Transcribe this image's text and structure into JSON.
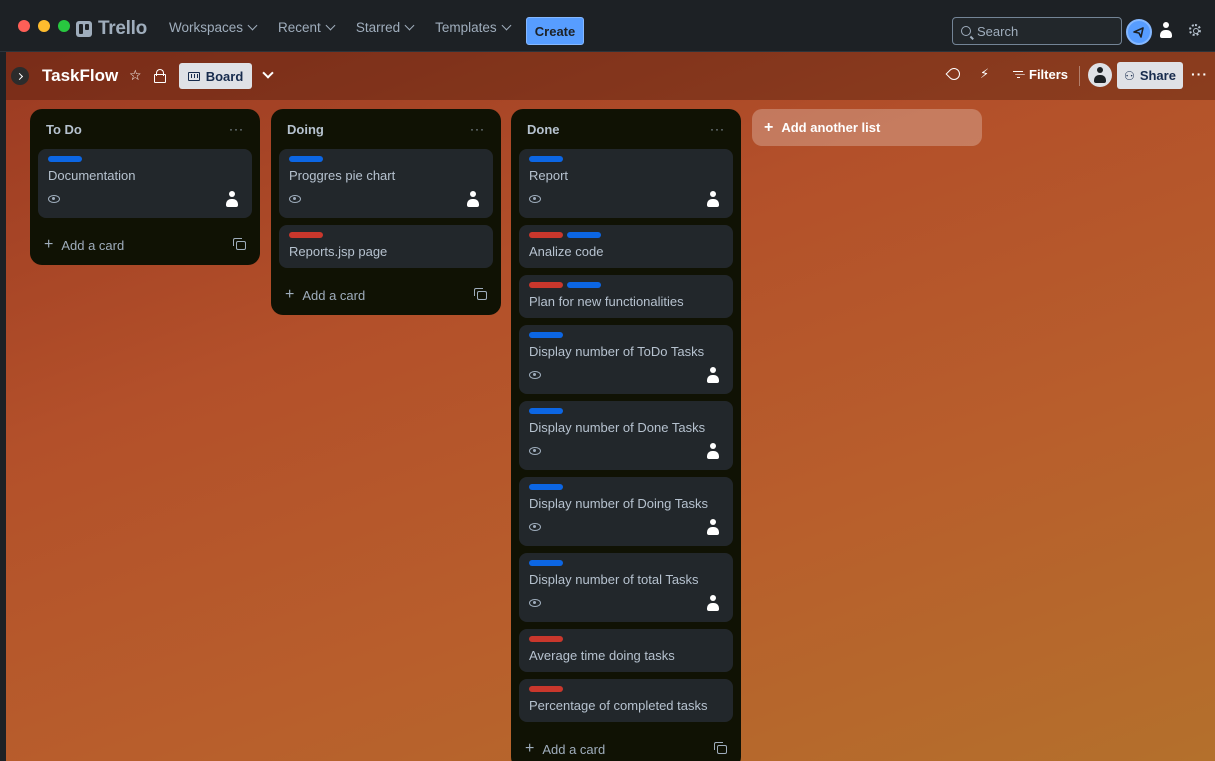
{
  "app": {
    "name": "Trello",
    "nav": [
      "Workspaces",
      "Recent",
      "Starred",
      "Templates"
    ],
    "create_label": "Create",
    "search_placeholder": "Search"
  },
  "board": {
    "title": "TaskFlow",
    "view_label": "Board",
    "filters_label": "Filters",
    "share_label": "Share",
    "add_list_label": "Add another list",
    "add_card_label": "Add a card"
  },
  "colors": {
    "label_blue": "#0c66e4",
    "label_red": "#c9372c",
    "accent": "#579dff"
  },
  "lists": [
    {
      "title": "To Do",
      "cards": [
        {
          "title": "Documentation",
          "labels": [
            "blue"
          ],
          "watch": true,
          "member": true
        }
      ]
    },
    {
      "title": "Doing",
      "cards": [
        {
          "title": "Proggres pie chart",
          "labels": [
            "blue"
          ],
          "watch": true,
          "member": true
        },
        {
          "title": "Reports.jsp page",
          "labels": [
            "red"
          ],
          "watch": false,
          "member": false
        }
      ]
    },
    {
      "title": "Done",
      "cards": [
        {
          "title": "Report",
          "labels": [
            "blue"
          ],
          "watch": true,
          "member": true
        },
        {
          "title": "Analize code",
          "labels": [
            "red",
            "blue"
          ],
          "watch": false,
          "member": false
        },
        {
          "title": "Plan for new functionalities",
          "labels": [
            "red",
            "blue"
          ],
          "watch": false,
          "member": false
        },
        {
          "title": "Display number of ToDo Tasks",
          "labels": [
            "blue"
          ],
          "watch": true,
          "member": true
        },
        {
          "title": "Display number of Done Tasks",
          "labels": [
            "blue"
          ],
          "watch": true,
          "member": true
        },
        {
          "title": "Display number of Doing Tasks",
          "labels": [
            "blue"
          ],
          "watch": true,
          "member": true
        },
        {
          "title": "Display number of total Tasks",
          "labels": [
            "blue"
          ],
          "watch": true,
          "member": true
        },
        {
          "title": "Average time doing tasks",
          "labels": [
            "red"
          ],
          "watch": false,
          "member": false
        },
        {
          "title": "Percentage of completed tasks",
          "labels": [
            "red"
          ],
          "watch": false,
          "member": false
        }
      ]
    }
  ]
}
